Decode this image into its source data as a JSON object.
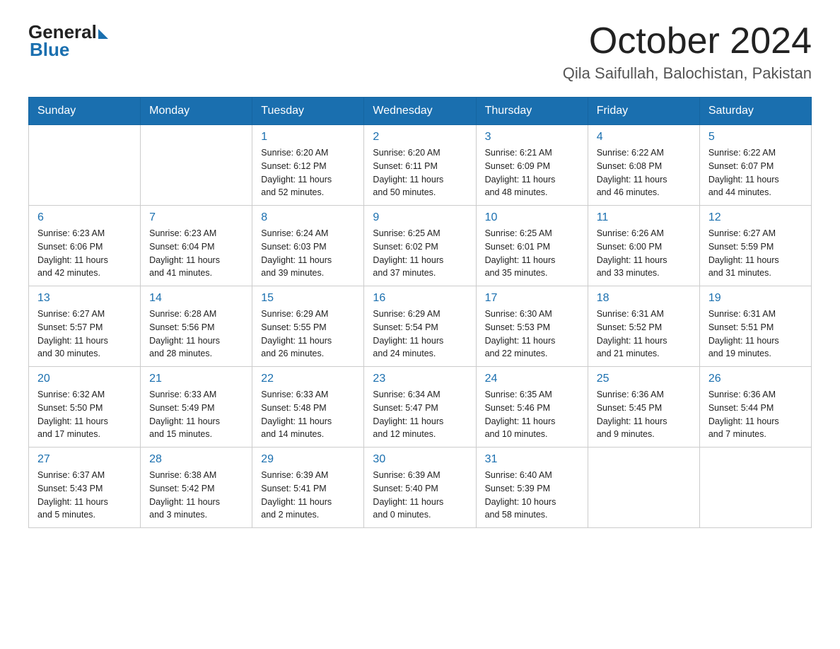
{
  "header": {
    "logo_general": "General",
    "logo_blue": "Blue",
    "month_title": "October 2024",
    "location": "Qila Saifullah, Balochistan, Pakistan"
  },
  "weekdays": [
    "Sunday",
    "Monday",
    "Tuesday",
    "Wednesday",
    "Thursday",
    "Friday",
    "Saturday"
  ],
  "weeks": [
    [
      {
        "day": "",
        "info": ""
      },
      {
        "day": "",
        "info": ""
      },
      {
        "day": "1",
        "info": "Sunrise: 6:20 AM\nSunset: 6:12 PM\nDaylight: 11 hours\nand 52 minutes."
      },
      {
        "day": "2",
        "info": "Sunrise: 6:20 AM\nSunset: 6:11 PM\nDaylight: 11 hours\nand 50 minutes."
      },
      {
        "day": "3",
        "info": "Sunrise: 6:21 AM\nSunset: 6:09 PM\nDaylight: 11 hours\nand 48 minutes."
      },
      {
        "day": "4",
        "info": "Sunrise: 6:22 AM\nSunset: 6:08 PM\nDaylight: 11 hours\nand 46 minutes."
      },
      {
        "day": "5",
        "info": "Sunrise: 6:22 AM\nSunset: 6:07 PM\nDaylight: 11 hours\nand 44 minutes."
      }
    ],
    [
      {
        "day": "6",
        "info": "Sunrise: 6:23 AM\nSunset: 6:06 PM\nDaylight: 11 hours\nand 42 minutes."
      },
      {
        "day": "7",
        "info": "Sunrise: 6:23 AM\nSunset: 6:04 PM\nDaylight: 11 hours\nand 41 minutes."
      },
      {
        "day": "8",
        "info": "Sunrise: 6:24 AM\nSunset: 6:03 PM\nDaylight: 11 hours\nand 39 minutes."
      },
      {
        "day": "9",
        "info": "Sunrise: 6:25 AM\nSunset: 6:02 PM\nDaylight: 11 hours\nand 37 minutes."
      },
      {
        "day": "10",
        "info": "Sunrise: 6:25 AM\nSunset: 6:01 PM\nDaylight: 11 hours\nand 35 minutes."
      },
      {
        "day": "11",
        "info": "Sunrise: 6:26 AM\nSunset: 6:00 PM\nDaylight: 11 hours\nand 33 minutes."
      },
      {
        "day": "12",
        "info": "Sunrise: 6:27 AM\nSunset: 5:59 PM\nDaylight: 11 hours\nand 31 minutes."
      }
    ],
    [
      {
        "day": "13",
        "info": "Sunrise: 6:27 AM\nSunset: 5:57 PM\nDaylight: 11 hours\nand 30 minutes."
      },
      {
        "day": "14",
        "info": "Sunrise: 6:28 AM\nSunset: 5:56 PM\nDaylight: 11 hours\nand 28 minutes."
      },
      {
        "day": "15",
        "info": "Sunrise: 6:29 AM\nSunset: 5:55 PM\nDaylight: 11 hours\nand 26 minutes."
      },
      {
        "day": "16",
        "info": "Sunrise: 6:29 AM\nSunset: 5:54 PM\nDaylight: 11 hours\nand 24 minutes."
      },
      {
        "day": "17",
        "info": "Sunrise: 6:30 AM\nSunset: 5:53 PM\nDaylight: 11 hours\nand 22 minutes."
      },
      {
        "day": "18",
        "info": "Sunrise: 6:31 AM\nSunset: 5:52 PM\nDaylight: 11 hours\nand 21 minutes."
      },
      {
        "day": "19",
        "info": "Sunrise: 6:31 AM\nSunset: 5:51 PM\nDaylight: 11 hours\nand 19 minutes."
      }
    ],
    [
      {
        "day": "20",
        "info": "Sunrise: 6:32 AM\nSunset: 5:50 PM\nDaylight: 11 hours\nand 17 minutes."
      },
      {
        "day": "21",
        "info": "Sunrise: 6:33 AM\nSunset: 5:49 PM\nDaylight: 11 hours\nand 15 minutes."
      },
      {
        "day": "22",
        "info": "Sunrise: 6:33 AM\nSunset: 5:48 PM\nDaylight: 11 hours\nand 14 minutes."
      },
      {
        "day": "23",
        "info": "Sunrise: 6:34 AM\nSunset: 5:47 PM\nDaylight: 11 hours\nand 12 minutes."
      },
      {
        "day": "24",
        "info": "Sunrise: 6:35 AM\nSunset: 5:46 PM\nDaylight: 11 hours\nand 10 minutes."
      },
      {
        "day": "25",
        "info": "Sunrise: 6:36 AM\nSunset: 5:45 PM\nDaylight: 11 hours\nand 9 minutes."
      },
      {
        "day": "26",
        "info": "Sunrise: 6:36 AM\nSunset: 5:44 PM\nDaylight: 11 hours\nand 7 minutes."
      }
    ],
    [
      {
        "day": "27",
        "info": "Sunrise: 6:37 AM\nSunset: 5:43 PM\nDaylight: 11 hours\nand 5 minutes."
      },
      {
        "day": "28",
        "info": "Sunrise: 6:38 AM\nSunset: 5:42 PM\nDaylight: 11 hours\nand 3 minutes."
      },
      {
        "day": "29",
        "info": "Sunrise: 6:39 AM\nSunset: 5:41 PM\nDaylight: 11 hours\nand 2 minutes."
      },
      {
        "day": "30",
        "info": "Sunrise: 6:39 AM\nSunset: 5:40 PM\nDaylight: 11 hours\nand 0 minutes."
      },
      {
        "day": "31",
        "info": "Sunrise: 6:40 AM\nSunset: 5:39 PM\nDaylight: 10 hours\nand 58 minutes."
      },
      {
        "day": "",
        "info": ""
      },
      {
        "day": "",
        "info": ""
      }
    ]
  ]
}
